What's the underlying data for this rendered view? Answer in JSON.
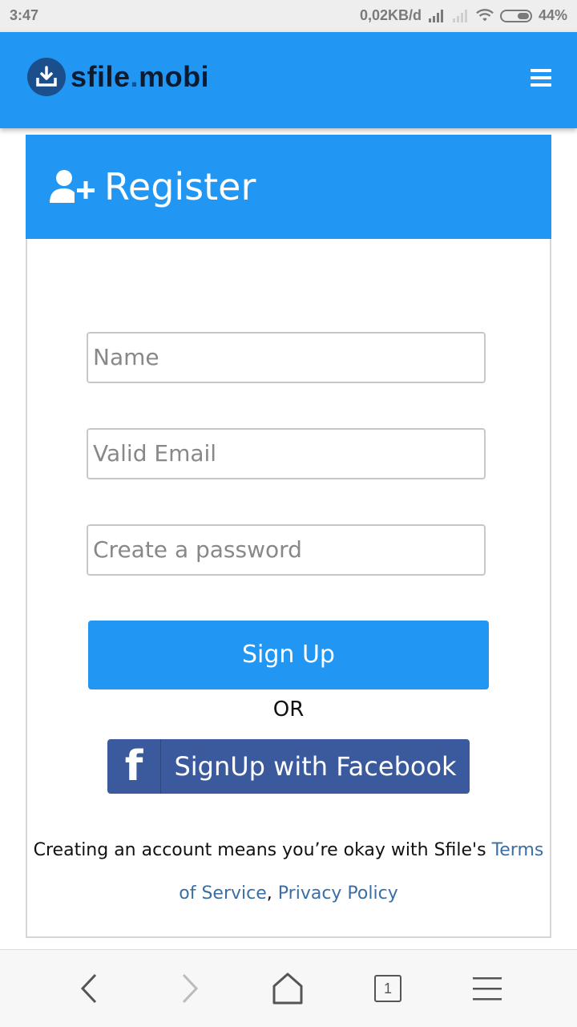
{
  "status_bar": {
    "time": "3:47",
    "network_speed": "0,02KB/d",
    "battery": "44%"
  },
  "header": {
    "logo_text_a": "sfile",
    "logo_dot": ".",
    "logo_text_b": "mobi",
    "menu_icon": "hamburger-icon"
  },
  "register": {
    "title": "Register",
    "name_placeholder": "Name",
    "email_placeholder": "Valid Email",
    "password_placeholder": "Create a password",
    "signup_label": "Sign Up",
    "or_label": "OR",
    "facebook_icon_text": "f",
    "facebook_label": "SignUp with Facebook",
    "terms_prefix": "Creating an account means you’re okay with Sfile's ",
    "terms_link": "Terms of Service",
    "terms_separator": ", ",
    "privacy_link": "Privacy Policy"
  },
  "browser_bar": {
    "tab_count": "1"
  },
  "colors": {
    "primary": "#2196f3",
    "facebook": "#3b5a9d",
    "link": "#3a6ea5"
  }
}
